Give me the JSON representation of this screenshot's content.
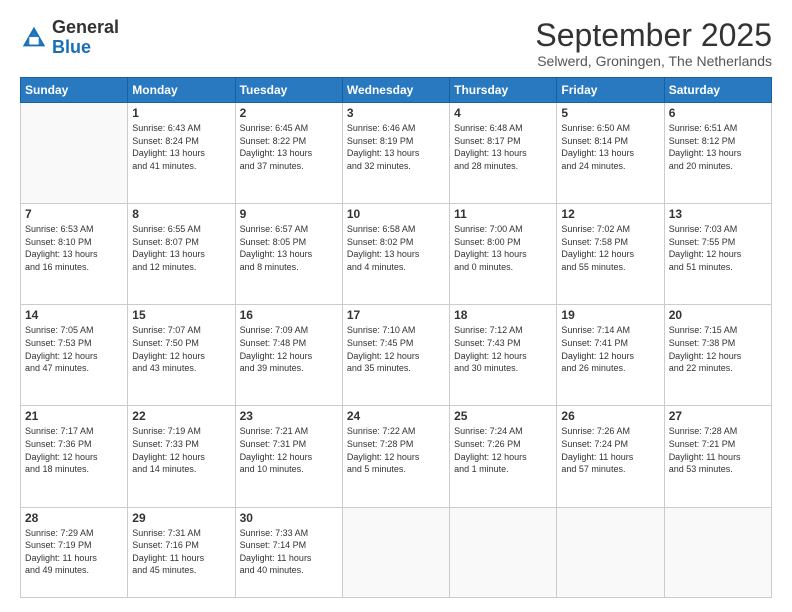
{
  "logo": {
    "general": "General",
    "blue": "Blue"
  },
  "header": {
    "month": "September 2025",
    "location": "Selwerd, Groningen, The Netherlands"
  },
  "days": [
    "Sunday",
    "Monday",
    "Tuesday",
    "Wednesday",
    "Thursday",
    "Friday",
    "Saturday"
  ],
  "weeks": [
    [
      {
        "day": "",
        "info": ""
      },
      {
        "day": "1",
        "info": "Sunrise: 6:43 AM\nSunset: 8:24 PM\nDaylight: 13 hours\nand 41 minutes."
      },
      {
        "day": "2",
        "info": "Sunrise: 6:45 AM\nSunset: 8:22 PM\nDaylight: 13 hours\nand 37 minutes."
      },
      {
        "day": "3",
        "info": "Sunrise: 6:46 AM\nSunset: 8:19 PM\nDaylight: 13 hours\nand 32 minutes."
      },
      {
        "day": "4",
        "info": "Sunrise: 6:48 AM\nSunset: 8:17 PM\nDaylight: 13 hours\nand 28 minutes."
      },
      {
        "day": "5",
        "info": "Sunrise: 6:50 AM\nSunset: 8:14 PM\nDaylight: 13 hours\nand 24 minutes."
      },
      {
        "day": "6",
        "info": "Sunrise: 6:51 AM\nSunset: 8:12 PM\nDaylight: 13 hours\nand 20 minutes."
      }
    ],
    [
      {
        "day": "7",
        "info": "Sunrise: 6:53 AM\nSunset: 8:10 PM\nDaylight: 13 hours\nand 16 minutes."
      },
      {
        "day": "8",
        "info": "Sunrise: 6:55 AM\nSunset: 8:07 PM\nDaylight: 13 hours\nand 12 minutes."
      },
      {
        "day": "9",
        "info": "Sunrise: 6:57 AM\nSunset: 8:05 PM\nDaylight: 13 hours\nand 8 minutes."
      },
      {
        "day": "10",
        "info": "Sunrise: 6:58 AM\nSunset: 8:02 PM\nDaylight: 13 hours\nand 4 minutes."
      },
      {
        "day": "11",
        "info": "Sunrise: 7:00 AM\nSunset: 8:00 PM\nDaylight: 13 hours\nand 0 minutes."
      },
      {
        "day": "12",
        "info": "Sunrise: 7:02 AM\nSunset: 7:58 PM\nDaylight: 12 hours\nand 55 minutes."
      },
      {
        "day": "13",
        "info": "Sunrise: 7:03 AM\nSunset: 7:55 PM\nDaylight: 12 hours\nand 51 minutes."
      }
    ],
    [
      {
        "day": "14",
        "info": "Sunrise: 7:05 AM\nSunset: 7:53 PM\nDaylight: 12 hours\nand 47 minutes."
      },
      {
        "day": "15",
        "info": "Sunrise: 7:07 AM\nSunset: 7:50 PM\nDaylight: 12 hours\nand 43 minutes."
      },
      {
        "day": "16",
        "info": "Sunrise: 7:09 AM\nSunset: 7:48 PM\nDaylight: 12 hours\nand 39 minutes."
      },
      {
        "day": "17",
        "info": "Sunrise: 7:10 AM\nSunset: 7:45 PM\nDaylight: 12 hours\nand 35 minutes."
      },
      {
        "day": "18",
        "info": "Sunrise: 7:12 AM\nSunset: 7:43 PM\nDaylight: 12 hours\nand 30 minutes."
      },
      {
        "day": "19",
        "info": "Sunrise: 7:14 AM\nSunset: 7:41 PM\nDaylight: 12 hours\nand 26 minutes."
      },
      {
        "day": "20",
        "info": "Sunrise: 7:15 AM\nSunset: 7:38 PM\nDaylight: 12 hours\nand 22 minutes."
      }
    ],
    [
      {
        "day": "21",
        "info": "Sunrise: 7:17 AM\nSunset: 7:36 PM\nDaylight: 12 hours\nand 18 minutes."
      },
      {
        "day": "22",
        "info": "Sunrise: 7:19 AM\nSunset: 7:33 PM\nDaylight: 12 hours\nand 14 minutes."
      },
      {
        "day": "23",
        "info": "Sunrise: 7:21 AM\nSunset: 7:31 PM\nDaylight: 12 hours\nand 10 minutes."
      },
      {
        "day": "24",
        "info": "Sunrise: 7:22 AM\nSunset: 7:28 PM\nDaylight: 12 hours\nand 5 minutes."
      },
      {
        "day": "25",
        "info": "Sunrise: 7:24 AM\nSunset: 7:26 PM\nDaylight: 12 hours\nand 1 minute."
      },
      {
        "day": "26",
        "info": "Sunrise: 7:26 AM\nSunset: 7:24 PM\nDaylight: 11 hours\nand 57 minutes."
      },
      {
        "day": "27",
        "info": "Sunrise: 7:28 AM\nSunset: 7:21 PM\nDaylight: 11 hours\nand 53 minutes."
      }
    ],
    [
      {
        "day": "28",
        "info": "Sunrise: 7:29 AM\nSunset: 7:19 PM\nDaylight: 11 hours\nand 49 minutes."
      },
      {
        "day": "29",
        "info": "Sunrise: 7:31 AM\nSunset: 7:16 PM\nDaylight: 11 hours\nand 45 minutes."
      },
      {
        "day": "30",
        "info": "Sunrise: 7:33 AM\nSunset: 7:14 PM\nDaylight: 11 hours\nand 40 minutes."
      },
      {
        "day": "",
        "info": ""
      },
      {
        "day": "",
        "info": ""
      },
      {
        "day": "",
        "info": ""
      },
      {
        "day": "",
        "info": ""
      }
    ]
  ]
}
